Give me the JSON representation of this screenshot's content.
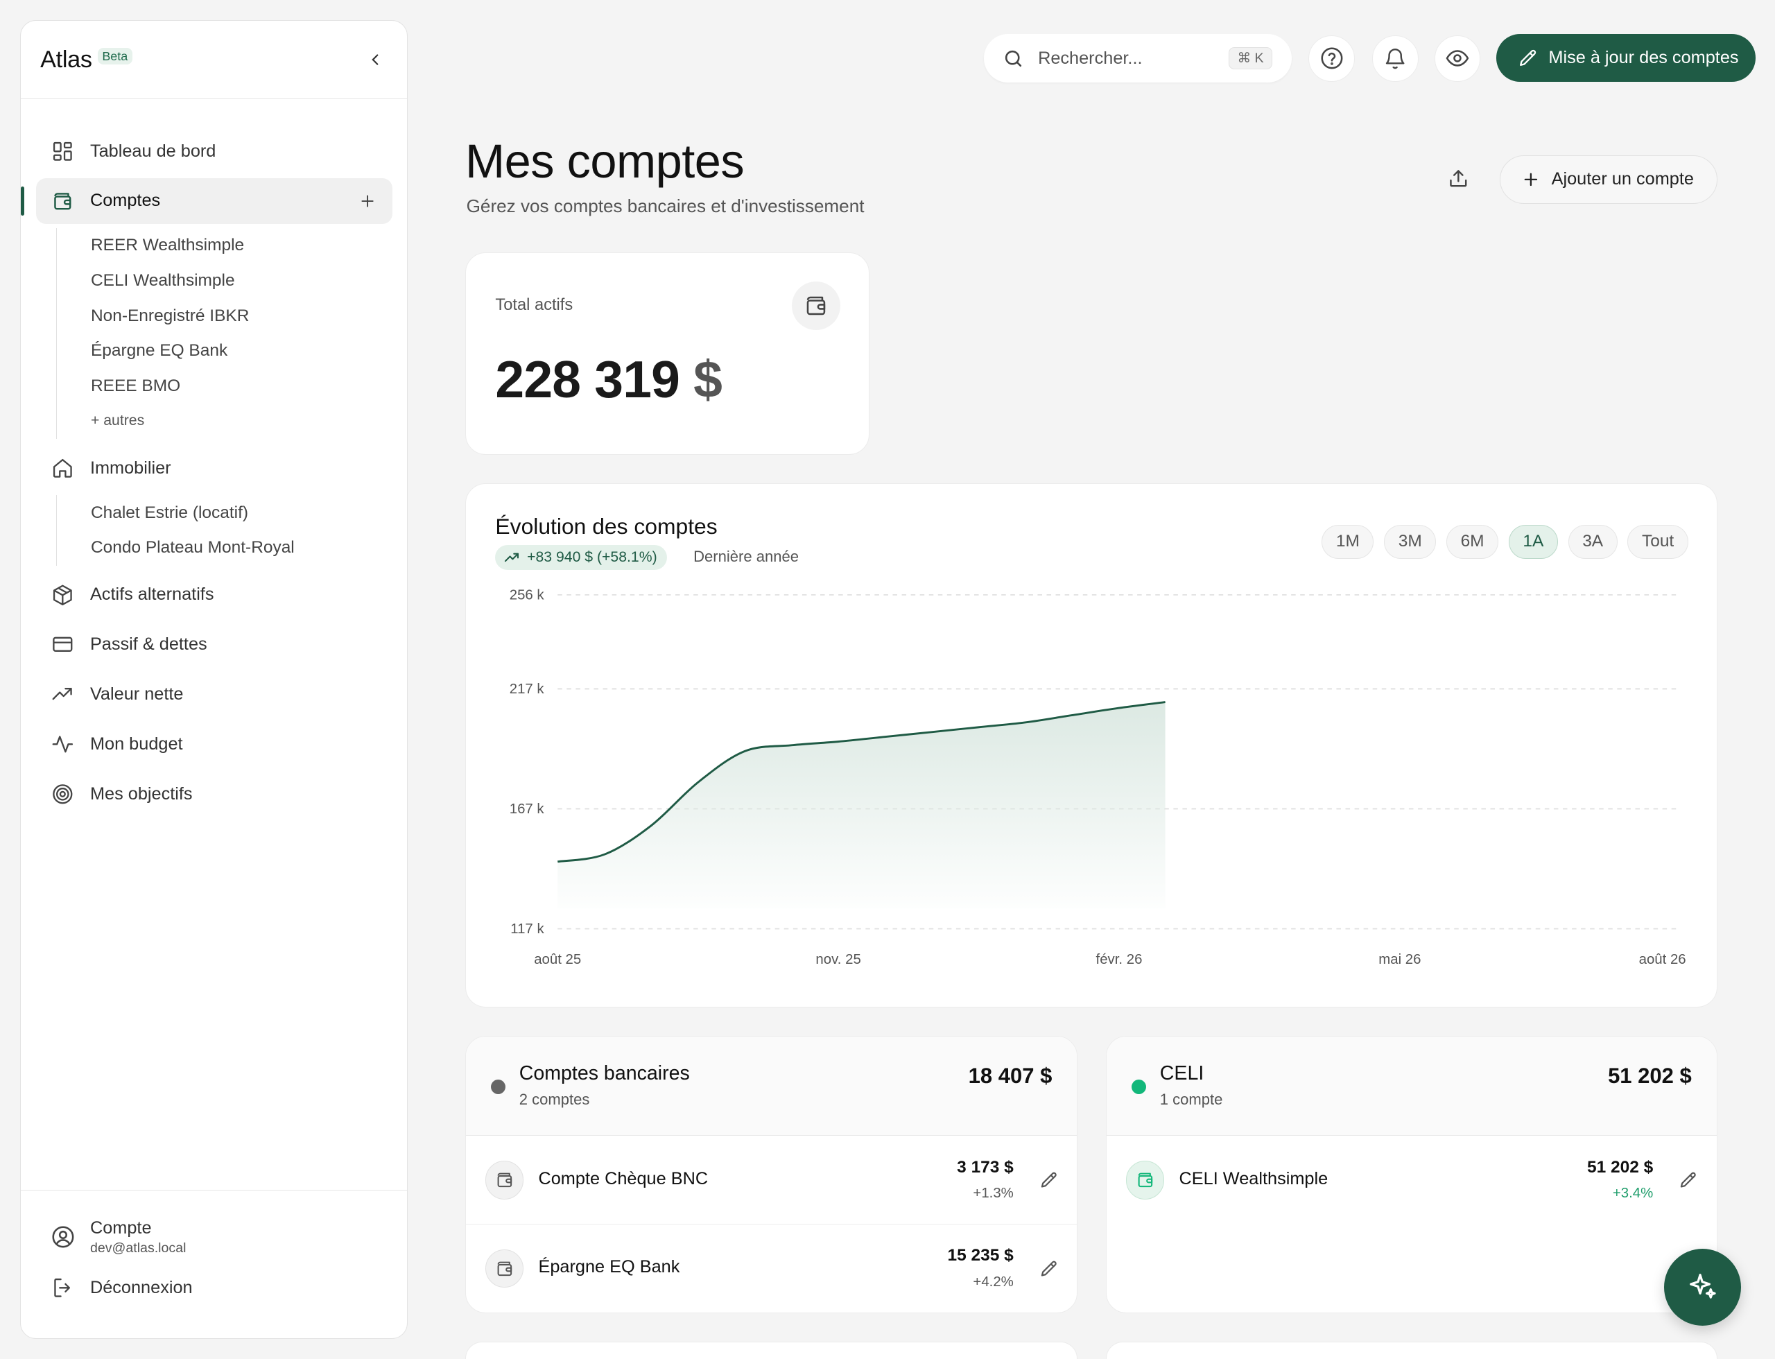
{
  "app": {
    "name": "Atlas",
    "badge": "Beta"
  },
  "sidebar": {
    "items": [
      {
        "label": "Tableau de bord",
        "icon": "grid-icon"
      },
      {
        "label": "Comptes",
        "icon": "wallet-icon",
        "active": true,
        "children": [
          "REER Wealthsimple",
          "CELI Wealthsimple",
          "Non-Enregistré IBKR",
          "Épargne EQ Bank",
          "REEE BMO"
        ],
        "more": "+ autres"
      },
      {
        "label": "Immobilier",
        "icon": "home-icon",
        "children": [
          "Chalet Estrie (locatif)",
          "Condo Plateau Mont-Royal"
        ]
      },
      {
        "label": "Actifs alternatifs",
        "icon": "box-icon"
      },
      {
        "label": "Passif & dettes",
        "icon": "credit-card-icon"
      },
      {
        "label": "Valeur nette",
        "icon": "trending-up-icon"
      },
      {
        "label": "Mon budget",
        "icon": "activity-icon"
      },
      {
        "label": "Mes objectifs",
        "icon": "target-icon"
      }
    ],
    "footer": {
      "account_label": "Compte",
      "email": "dev@atlas.local",
      "logout": "Déconnexion"
    }
  },
  "topbar": {
    "search_placeholder": "Rechercher...",
    "shortcut": "⌘ K",
    "update_button": "Mise à jour des comptes"
  },
  "header": {
    "title": "Mes comptes",
    "subtitle": "Gérez vos comptes bancaires et d'investissement",
    "add_button": "Ajouter un compte"
  },
  "total": {
    "label": "Total actifs",
    "amount": "228 319",
    "currency": "$"
  },
  "evolution": {
    "title": "Évolution des comptes",
    "change": "+83 940 $ (+58.1%)",
    "period": "Dernière année",
    "ranges": [
      "1M",
      "3M",
      "6M",
      "1A",
      "3A",
      "Tout"
    ],
    "active_range": "1A"
  },
  "chart_data": {
    "type": "area",
    "x_ticks": [
      "août 25",
      "nov. 25",
      "févr. 26",
      "mai 26",
      "août 26"
    ],
    "y_ticks": [
      "256 k",
      "217 k",
      "167 k",
      "117 k"
    ],
    "ylim": [
      117,
      256
    ],
    "series": [
      {
        "x": [
          0,
          0.5,
          1,
          1.5,
          2,
          2.5,
          3,
          3.5,
          4,
          4.5,
          5,
          5.5,
          6,
          6.5
        ],
        "values": [
          145,
          148,
          160,
          178,
          191,
          193.5,
          195,
          197,
          199,
          201,
          203,
          206,
          209,
          211.5
        ]
      }
    ],
    "colors": {
      "line": "#1f5b45",
      "fill": "#dce9e3"
    },
    "grid": true
  },
  "groups": [
    {
      "name": "Comptes bancaires",
      "count": "2 comptes",
      "total": "18 407 $",
      "color": "#666666",
      "accounts": [
        {
          "name": "Compte Chèque BNC",
          "amount": "3 173 $",
          "change": "+1.3%",
          "positive": false
        },
        {
          "name": "Épargne EQ Bank",
          "amount": "15 235 $",
          "change": "+4.2%",
          "positive": false
        }
      ]
    },
    {
      "name": "CELI",
      "count": "1 compte",
      "total": "51 202 $",
      "color": "#12b77a",
      "accounts": [
        {
          "name": "CELI Wealthsimple",
          "amount": "51 202 $",
          "change": "+3.4%",
          "positive": true
        }
      ]
    }
  ]
}
